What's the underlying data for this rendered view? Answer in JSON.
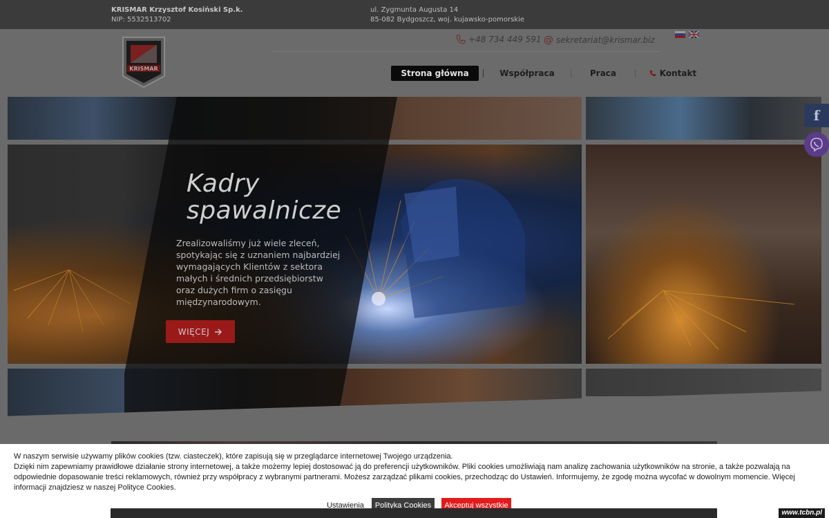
{
  "topbar": {
    "company_name": "KRISMAR Krzysztof Kosiński Sp.k.",
    "nip": "NIP: 5532513702",
    "address_line1": "ul. Zygmunta Augusta 14",
    "address_line2": "85-082 Bydgoszcz, woj. kujawsko-pomorskie"
  },
  "header": {
    "logo_text": "KRISMAR",
    "phone": "+48 734 449 591",
    "email": "sekretariat@krismar.biz",
    "languages": [
      "ru",
      "en"
    ]
  },
  "nav": {
    "items": [
      {
        "label": "Strona główna",
        "active": true
      },
      {
        "label": "Współpraca",
        "active": false
      },
      {
        "label": "Praca",
        "active": false
      },
      {
        "label": "Kontakt",
        "active": false,
        "icon": "phone-icon"
      }
    ]
  },
  "hero": {
    "title_line1": "Kadry",
    "title_line2": "spawalnicze",
    "text": "Zrealizowaliśmy już wiele zleceń, spotykając się z uznaniem najbardziej wymagających Klientów z sektora małych i średnich przedsiębiorstw oraz dużych firm o zasięgu międzynarodowym.",
    "button_label": "WIĘCEJ"
  },
  "social": {
    "facebook_glyph": "f",
    "icons": [
      "facebook-icon",
      "viber-icon"
    ]
  },
  "cookie": {
    "line1": "W naszym serwisie używamy plików cookies (tzw. ciasteczek), które zapisują się w przeglądarce internetowej Twojego urządzenia.",
    "line2": "Dzięki nim zapewniamy prawidłowe działanie strony internetowej, a także możemy lepiej dostosować ją do preferencji użytkowników. Pliki cookies umożliwiają nam analizę zachowania użytkowników na stronie, a także pozwalają na odpowiednie dopasowanie treści reklamowych, również przy współpracy z wybranymi partnerami. Możesz zarządzać plikami cookies, przechodząc do Ustawień. Informujemy, że zgodę można wycofać w dowolnym momencie. Więcej informacji znajdziesz w naszej Polityce Cookies.",
    "settings_label": "Ustawienia",
    "policy_label": "Polityka Cookies",
    "accept_label": "Akceptuj wszystkie"
  },
  "watermark": "www.tcbn.pl",
  "colors": {
    "accent_red": "#e21b1b",
    "hero_button": "#9a1a1a",
    "nav_active_bg": "#0a0a0a",
    "topbar_bg": "#3b3b3b"
  }
}
